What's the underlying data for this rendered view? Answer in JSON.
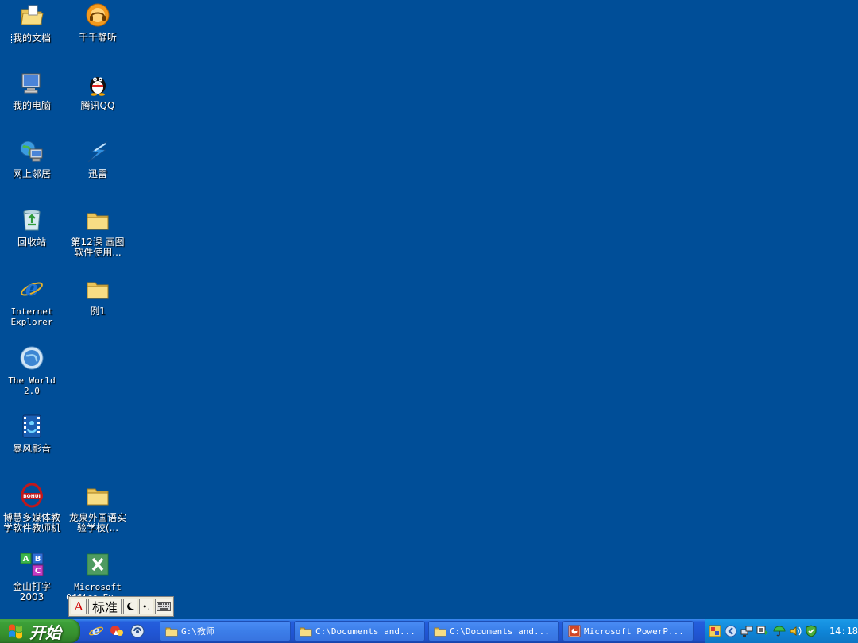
{
  "desktop": {
    "background_color": "#004e98",
    "icons": [
      {
        "id": "my-documents",
        "label": "我的文档",
        "icon": "folder-open-icon"
      },
      {
        "id": "qianqian",
        "label": "千千静听",
        "icon": "music-player-icon"
      },
      {
        "id": "my-computer",
        "label": "我的电脑",
        "icon": "computer-icon"
      },
      {
        "id": "tencent-qq",
        "label": "腾讯QQ",
        "icon": "penguin-icon"
      },
      {
        "id": "network",
        "label": "网上邻居",
        "icon": "network-icon"
      },
      {
        "id": "xunlei",
        "label": "迅雷",
        "icon": "thunder-icon"
      },
      {
        "id": "recycle-bin",
        "label": "回收站",
        "icon": "recycle-bin-icon"
      },
      {
        "id": "lesson12",
        "label": "第12课 画图\n软件使用...",
        "icon": "folder-icon"
      },
      {
        "id": "ie",
        "label": "Internet\nExplorer",
        "icon": "ie-icon"
      },
      {
        "id": "example1",
        "label": "例1",
        "icon": "folder-icon"
      },
      {
        "id": "theworld",
        "label": "The World\n2.0",
        "icon": "globe-icon"
      },
      {
        "id": "baofeng",
        "label": "暴风影音",
        "icon": "video-player-icon"
      },
      {
        "id": "bohui",
        "label": "博慧多媒体教\n学软件教师机",
        "icon": "bohui-logo-icon"
      },
      {
        "id": "longquan",
        "label": "龙泉外国语实\n验学校(...",
        "icon": "folder-icon"
      },
      {
        "id": "jinshan",
        "label": "金山打字\n2003",
        "icon": "abc-blocks-icon"
      },
      {
        "id": "excel",
        "label": "Microsoft\nOffice Ex...",
        "icon": "excel-icon"
      }
    ]
  },
  "ime_bar": {
    "mode_label": "标准",
    "a_label": "A",
    "punct_label": "•,",
    "icons": [
      "ime-a-icon",
      "half-moon-icon",
      "punctuation-icon",
      "keyboard-icon"
    ]
  },
  "taskbar": {
    "start_label": "开始",
    "quicklaunch": [
      "ie-icon",
      "app-launch-icon",
      "media-icon"
    ],
    "tasks": [
      {
        "label": "G:\\教师",
        "icon": "folder-icon"
      },
      {
        "label": "C:\\Documents and...",
        "icon": "folder-icon"
      },
      {
        "label": "C:\\Documents and...",
        "icon": "folder-icon"
      },
      {
        "label": "Microsoft PowerP...",
        "icon": "powerpoint-icon"
      }
    ],
    "tray_icons": [
      "ime-tray-icon",
      "back-arrow-icon",
      "network-tray-icon",
      "monitor-tray-icon",
      "umbrella-tray-icon",
      "sound-tray-icon",
      "security-tray-icon"
    ],
    "clock": "14:18"
  }
}
